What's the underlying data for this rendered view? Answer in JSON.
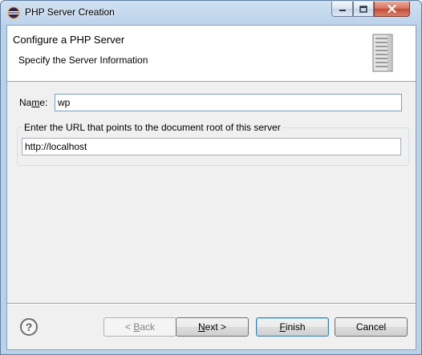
{
  "window": {
    "title": "PHP Server Creation",
    "icons": {
      "app": "eclipse-icon",
      "minimize": "minimize-icon",
      "maximize": "maximize-icon",
      "close": "close-icon"
    }
  },
  "header": {
    "title": "Configure a PHP Server",
    "description": "Specify the Server Information",
    "banner_icon": "server-icon"
  },
  "form": {
    "name_label_prefix": "Na",
    "name_label_mnemonic": "m",
    "name_label_suffix": "e:",
    "name_value": "wp",
    "url_group_label": "Enter the URL that points to the document root of this server",
    "url_value": "http://localhost"
  },
  "buttons": {
    "help_icon": "help-icon",
    "back_prefix": "< ",
    "back_mnemonic": "B",
    "back_suffix": "ack",
    "next_mnemonic": "N",
    "next_suffix": "ext >",
    "finish_mnemonic": "F",
    "finish_suffix": "inish",
    "cancel_label": "Cancel"
  },
  "colors": {
    "client_background": "#f0f0f0",
    "header_background": "#ffffff",
    "focus_border": "#7a9cc6",
    "default_button_border": "#3c7fb1"
  }
}
